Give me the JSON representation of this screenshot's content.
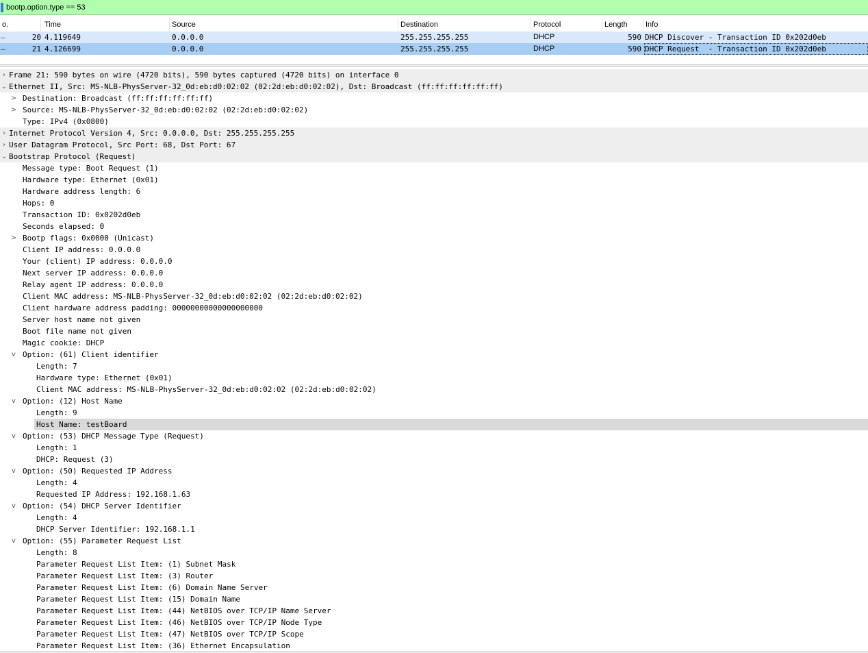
{
  "filter": {
    "text": "bootp.option.type == 53"
  },
  "packet_list": {
    "columns": [
      "o.",
      "Time",
      "Source",
      "Destination",
      "Protocol",
      "Length",
      "Info"
    ],
    "rows": [
      {
        "mark": "–",
        "no": "20",
        "time": "4.119649",
        "source": "0.0.0.0",
        "destination": "255.255.255.255",
        "protocol": "DHCP",
        "length": "590",
        "info": "DHCP Discover - Transaction ID 0x202d0eb"
      },
      {
        "mark": "–",
        "no": "21",
        "time": "4.126699",
        "source": "0.0.0.0",
        "destination": "255.255.255.255",
        "protocol": "DHCP",
        "length": "590",
        "info": "DHCP Request  - Transaction ID 0x202d0eb"
      }
    ]
  },
  "details": [
    {
      "text": "Frame 21: 590 bytes on wire (4720 bits), 590 bytes captured (4720 bits) on interface 0",
      "level": 0,
      "arrow": "›",
      "kind": "top"
    },
    {
      "text": "Ethernet II, Src: MS-NLB-PhysServer-32_0d:eb:d0:02:02 (02:2d:eb:d0:02:02), Dst: Broadcast (ff:ff:ff:ff:ff:ff)",
      "level": 0,
      "arrow": "⌄",
      "kind": "top"
    },
    {
      "text": "Destination: Broadcast (ff:ff:ff:ff:ff:ff)",
      "level": 1,
      "arrow": ">"
    },
    {
      "text": "Source: MS-NLB-PhysServer-32_0d:eb:d0:02:02 (02:2d:eb:d0:02:02)",
      "level": 1,
      "arrow": ">"
    },
    {
      "text": "Type: IPv4 (0x0800)",
      "level": 1,
      "arrow": ""
    },
    {
      "text": "Internet Protocol Version 4, Src: 0.0.0.0, Dst: 255.255.255.255",
      "level": 0,
      "arrow": "›",
      "kind": "top"
    },
    {
      "text": "User Datagram Protocol, Src Port: 68, Dst Port: 67",
      "level": 0,
      "arrow": "›",
      "kind": "top"
    },
    {
      "text": "Bootstrap Protocol (Request)",
      "level": 0,
      "arrow": "⌄",
      "kind": "top"
    },
    {
      "text": "Message type: Boot Request (1)",
      "level": 1,
      "arrow": ""
    },
    {
      "text": "Hardware type: Ethernet (0x01)",
      "level": 1,
      "arrow": ""
    },
    {
      "text": "Hardware address length: 6",
      "level": 1,
      "arrow": ""
    },
    {
      "text": "Hops: 0",
      "level": 1,
      "arrow": ""
    },
    {
      "text": "Transaction ID: 0x0202d0eb",
      "level": 1,
      "arrow": ""
    },
    {
      "text": "Seconds elapsed: 0",
      "level": 1,
      "arrow": ""
    },
    {
      "text": "Bootp flags: 0x0000 (Unicast)",
      "level": 1,
      "arrow": ">"
    },
    {
      "text": "Client IP address: 0.0.0.0",
      "level": 1,
      "arrow": ""
    },
    {
      "text": "Your (client) IP address: 0.0.0.0",
      "level": 1,
      "arrow": ""
    },
    {
      "text": "Next server IP address: 0.0.0.0",
      "level": 1,
      "arrow": ""
    },
    {
      "text": "Relay agent IP address: 0.0.0.0",
      "level": 1,
      "arrow": ""
    },
    {
      "text": "Client MAC address: MS-NLB-PhysServer-32_0d:eb:d0:02:02 (02:2d:eb:d0:02:02)",
      "level": 1,
      "arrow": ""
    },
    {
      "text": "Client hardware address padding: 00000000000000000000",
      "level": 1,
      "arrow": ""
    },
    {
      "text": "Server host name not given",
      "level": 1,
      "arrow": ""
    },
    {
      "text": "Boot file name not given",
      "level": 1,
      "arrow": ""
    },
    {
      "text": "Magic cookie: DHCP",
      "level": 1,
      "arrow": ""
    },
    {
      "text": "Option: (61) Client identifier",
      "level": 1,
      "arrow": "v"
    },
    {
      "text": "Length: 7",
      "level": 2,
      "arrow": ""
    },
    {
      "text": "Hardware type: Ethernet (0x01)",
      "level": 2,
      "arrow": ""
    },
    {
      "text": "Client MAC address: MS-NLB-PhysServer-32_0d:eb:d0:02:02 (02:2d:eb:d0:02:02)",
      "level": 2,
      "arrow": ""
    },
    {
      "text": "Option: (12) Host Name",
      "level": 1,
      "arrow": "v"
    },
    {
      "text": "Length: 9",
      "level": 2,
      "arrow": ""
    },
    {
      "text": "Host Name: testBoard",
      "level": 2,
      "arrow": "",
      "kind": "sel"
    },
    {
      "text": "Option: (53) DHCP Message Type (Request)",
      "level": 1,
      "arrow": "v"
    },
    {
      "text": "Length: 1",
      "level": 2,
      "arrow": ""
    },
    {
      "text": "DHCP: Request (3)",
      "level": 2,
      "arrow": ""
    },
    {
      "text": "Option: (50) Requested IP Address",
      "level": 1,
      "arrow": "v"
    },
    {
      "text": "Length: 4",
      "level": 2,
      "arrow": ""
    },
    {
      "text": "Requested IP Address: 192.168.1.63",
      "level": 2,
      "arrow": ""
    },
    {
      "text": "Option: (54) DHCP Server Identifier",
      "level": 1,
      "arrow": "v"
    },
    {
      "text": "Length: 4",
      "level": 2,
      "arrow": ""
    },
    {
      "text": "DHCP Server Identifier: 192.168.1.1",
      "level": 2,
      "arrow": ""
    },
    {
      "text": "Option: (55) Parameter Request List",
      "level": 1,
      "arrow": "v"
    },
    {
      "text": "Length: 8",
      "level": 2,
      "arrow": ""
    },
    {
      "text": "Parameter Request List Item: (1) Subnet Mask",
      "level": 2,
      "arrow": ""
    },
    {
      "text": "Parameter Request List Item: (3) Router",
      "level": 2,
      "arrow": ""
    },
    {
      "text": "Parameter Request List Item: (6) Domain Name Server",
      "level": 2,
      "arrow": ""
    },
    {
      "text": "Parameter Request List Item: (15) Domain Name",
      "level": 2,
      "arrow": ""
    },
    {
      "text": "Parameter Request List Item: (44) NetBIOS over TCP/IP Name Server",
      "level": 2,
      "arrow": ""
    },
    {
      "text": "Parameter Request List Item: (46) NetBIOS over TCP/IP Node Type",
      "level": 2,
      "arrow": ""
    },
    {
      "text": "Parameter Request List Item: (47) NetBIOS over TCP/IP Scope",
      "level": 2,
      "arrow": ""
    },
    {
      "text": "Parameter Request List Item: (36) Ethernet Encapsulation",
      "level": 2,
      "arrow": ""
    }
  ]
}
